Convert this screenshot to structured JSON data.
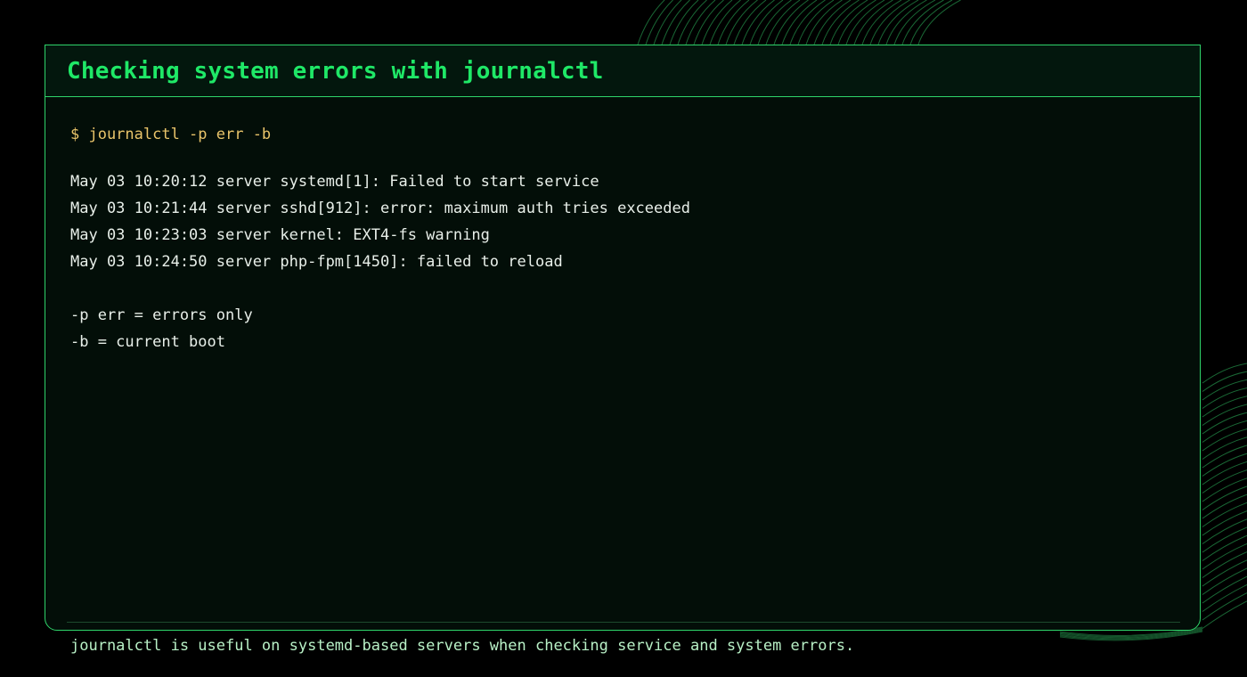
{
  "panel": {
    "title": "Checking system errors with journalctl"
  },
  "terminal": {
    "command": "$ journalctl -p err -b",
    "log_lines": [
      "May 03 10:20:12 server systemd[1]: Failed to start service",
      "May 03 10:21:44 server sshd[912]: error: maximum auth tries exceeded",
      "May 03 10:23:03 server kernel: EXT4-fs warning",
      "May 03 10:24:50 server php-fpm[1450]: failed to reload"
    ],
    "notes": [
      "-p err = errors only",
      "-b = current boot"
    ]
  },
  "footer": {
    "text": "journalctl is useful on systemd-based servers when checking service and system errors."
  },
  "colors": {
    "accent": "#2fd46a",
    "title": "#1fe867",
    "command": "#e9c46a",
    "text": "#e8efe9",
    "footer_text": "#b8f0c6",
    "background": "#000000",
    "panel_background": "#030e08"
  }
}
